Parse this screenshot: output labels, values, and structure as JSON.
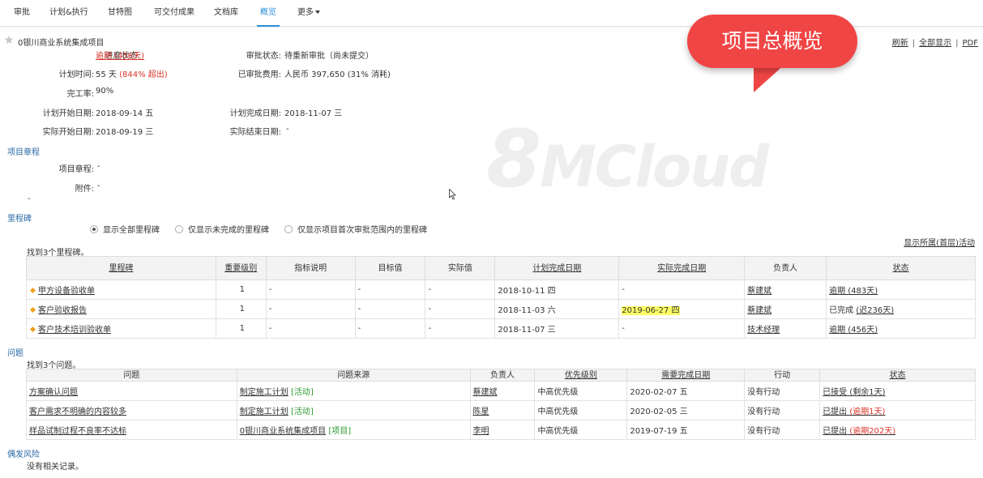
{
  "tabs": [
    {
      "label": "审批",
      "name": "tab-approval"
    },
    {
      "label": "计划&执行",
      "name": "tab-plan-execute"
    },
    {
      "label": "甘特图",
      "name": "tab-gantt"
    },
    {
      "label": "可交付成果",
      "name": "tab-deliverables"
    },
    {
      "label": "文档库",
      "name": "tab-documents"
    },
    {
      "label": "概览",
      "name": "tab-overview",
      "active": true
    },
    {
      "label": "更多",
      "name": "tab-more",
      "dropdown": true
    }
  ],
  "callout": "项目总概览",
  "toplinks": {
    "refresh": "刷新",
    "show_all": "全部显示",
    "pdf": "PDF",
    "sep": "|"
  },
  "project": {
    "title": "0银川商业系统集成项目",
    "progress_label": "进度状态:",
    "progress_value": "逾期 (456天)",
    "approval_label": "审批状态:",
    "approval_value": "待重新审批（尚未提交）",
    "plan_time_label": "计划时间:",
    "plan_time_value": "55 天",
    "plan_time_over": "(844% 超出)",
    "approved_cost_label": "已审批费用:",
    "approved_cost_value": "人民币 397,650",
    "approved_cost_pct": "(31% 消耗)",
    "completion_label": "完工率:",
    "completion_value": "90%",
    "plan_start_label": "计划开始日期:",
    "plan_start_value": "2018-09-14 五",
    "plan_end_label": "计划完成日期:",
    "plan_end_value": "2018-11-07 三",
    "actual_start_label": "实际开始日期:",
    "actual_start_value": "2018-09-19 三",
    "actual_end_label": "实际结束日期:",
    "actual_end_value": "-"
  },
  "charter": {
    "section": "项目章程",
    "charter_label": "项目章程:",
    "charter_value": "-",
    "attach_label": "附件:",
    "attach_value": "-",
    "extra": "-"
  },
  "milestones": {
    "section": "里程碑",
    "radios": [
      "显示全部里程碑",
      "仅显示未完成的里程碑",
      "仅显示项目首次审批范围内的里程碑"
    ],
    "show_activity_link": "显示所属(首层)活动",
    "found": "找到3个里程碑。",
    "headers": [
      "里程碑",
      "重要级别",
      "指标说明",
      "目标值",
      "实际值",
      "计划完成日期",
      "实际完成日期",
      "负责人",
      "状态"
    ],
    "rows": [
      {
        "name": "甲方设备验收单",
        "level": "1",
        "desc": "-",
        "target": "-",
        "actual": "-",
        "plan": "2018-10-11 四",
        "done": "-",
        "owner": "蔡建斌",
        "status_pre": "",
        "status": "逾期 (483天)"
      },
      {
        "name": "客户验收报告",
        "level": "1",
        "desc": "-",
        "target": "-",
        "actual": "-",
        "plan": "2018-11-03 六",
        "done": "2019-06-27 四",
        "owner": "蔡建斌",
        "status_pre": "已完成 ",
        "status": "(迟236天)"
      },
      {
        "name": "客户技术培训验收单",
        "level": "1",
        "desc": "-",
        "target": "-",
        "actual": "-",
        "plan": "2018-11-07 三",
        "done": "-",
        "owner": "技术经理",
        "status_pre": "",
        "status": "逾期 (456天)"
      }
    ]
  },
  "issues": {
    "section": "问题",
    "found": "找到3个问题。",
    "headers": [
      "问题",
      "问题来源",
      "负责人",
      "优先级别",
      "需要完成日期",
      "行动",
      "状态"
    ],
    "rows": [
      {
        "name": "方案确认问题",
        "source": "制定施工计划",
        "source_tag": "[活动]",
        "owner": "蔡建斌",
        "priority": "中高优先级",
        "due": "2020-02-07 五",
        "action": "没有行动",
        "status_pre": "已接受",
        "status": " (剩余1天)"
      },
      {
        "name": "客户需求不明确的内容较多",
        "source": "制定施工计划",
        "source_tag": "[活动]",
        "owner": "陈星",
        "priority": "中高优先级",
        "due": "2020-02-05 三",
        "action": "没有行动",
        "status_pre": "已提出",
        "status": " (逾期1天)"
      },
      {
        "name": "样品试制过程不良率不达标",
        "source": "0银川商业系统集成项目",
        "source_tag": "[项目]",
        "owner": "李明",
        "priority": "中高优先级",
        "due": "2019-07-19 五",
        "action": "没有行动",
        "status_pre": "已提出",
        "status": " (逾期202天)"
      }
    ]
  },
  "risks": {
    "section": "偶发风险",
    "empty": "没有相关记录。"
  },
  "watermark": "8MCloud",
  "colors": {
    "accent": "#2a8fd6",
    "red": "#d9342b",
    "callout": "#f04545",
    "green": "#2e9a2e"
  }
}
